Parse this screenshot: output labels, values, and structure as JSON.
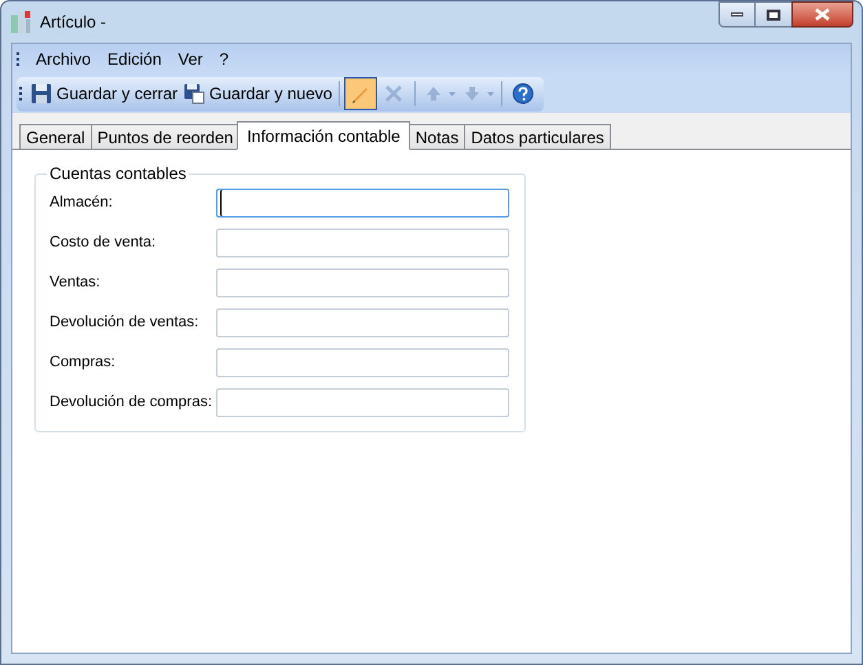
{
  "window": {
    "title": "Artículo -"
  },
  "menu": [
    "Archivo",
    "Edición",
    "Ver",
    "?"
  ],
  "toolbar": [
    {
      "kind": "text",
      "label": "Guardar y cerrar"
    },
    {
      "kind": "text",
      "label": "Guardar y nuevo"
    },
    {
      "kind": "separator"
    },
    {
      "kind": "toggle",
      "checked": true,
      "disabled": false
    },
    {
      "kind": "toggle",
      "checked": false,
      "disabled": true
    },
    {
      "kind": "separator"
    },
    {
      "kind": "dropdown",
      "disabled": true
    },
    {
      "kind": "dropdown",
      "disabled": true
    },
    {
      "kind": "separator"
    },
    {
      "kind": "plain"
    }
  ],
  "tabs": [
    {
      "label": "General",
      "selected": false
    },
    {
      "label": "Puntos de reorden",
      "selected": false
    },
    {
      "label": "Información contable",
      "selected": true
    },
    {
      "label": "Notas",
      "selected": false
    },
    {
      "label": "Datos particulares",
      "selected": false
    }
  ],
  "group": {
    "title": "Cuentas contables",
    "fields": [
      {
        "label": "Almacén:",
        "focused": true
      },
      {
        "label": "Costo de venta:",
        "focused": false
      },
      {
        "label": "Ventas:",
        "focused": false
      },
      {
        "label": "Devolución de ventas:",
        "focused": false
      },
      {
        "label": "Compras:",
        "focused": false
      },
      {
        "label": "Devolución de compras:",
        "focused": false
      }
    ]
  }
}
